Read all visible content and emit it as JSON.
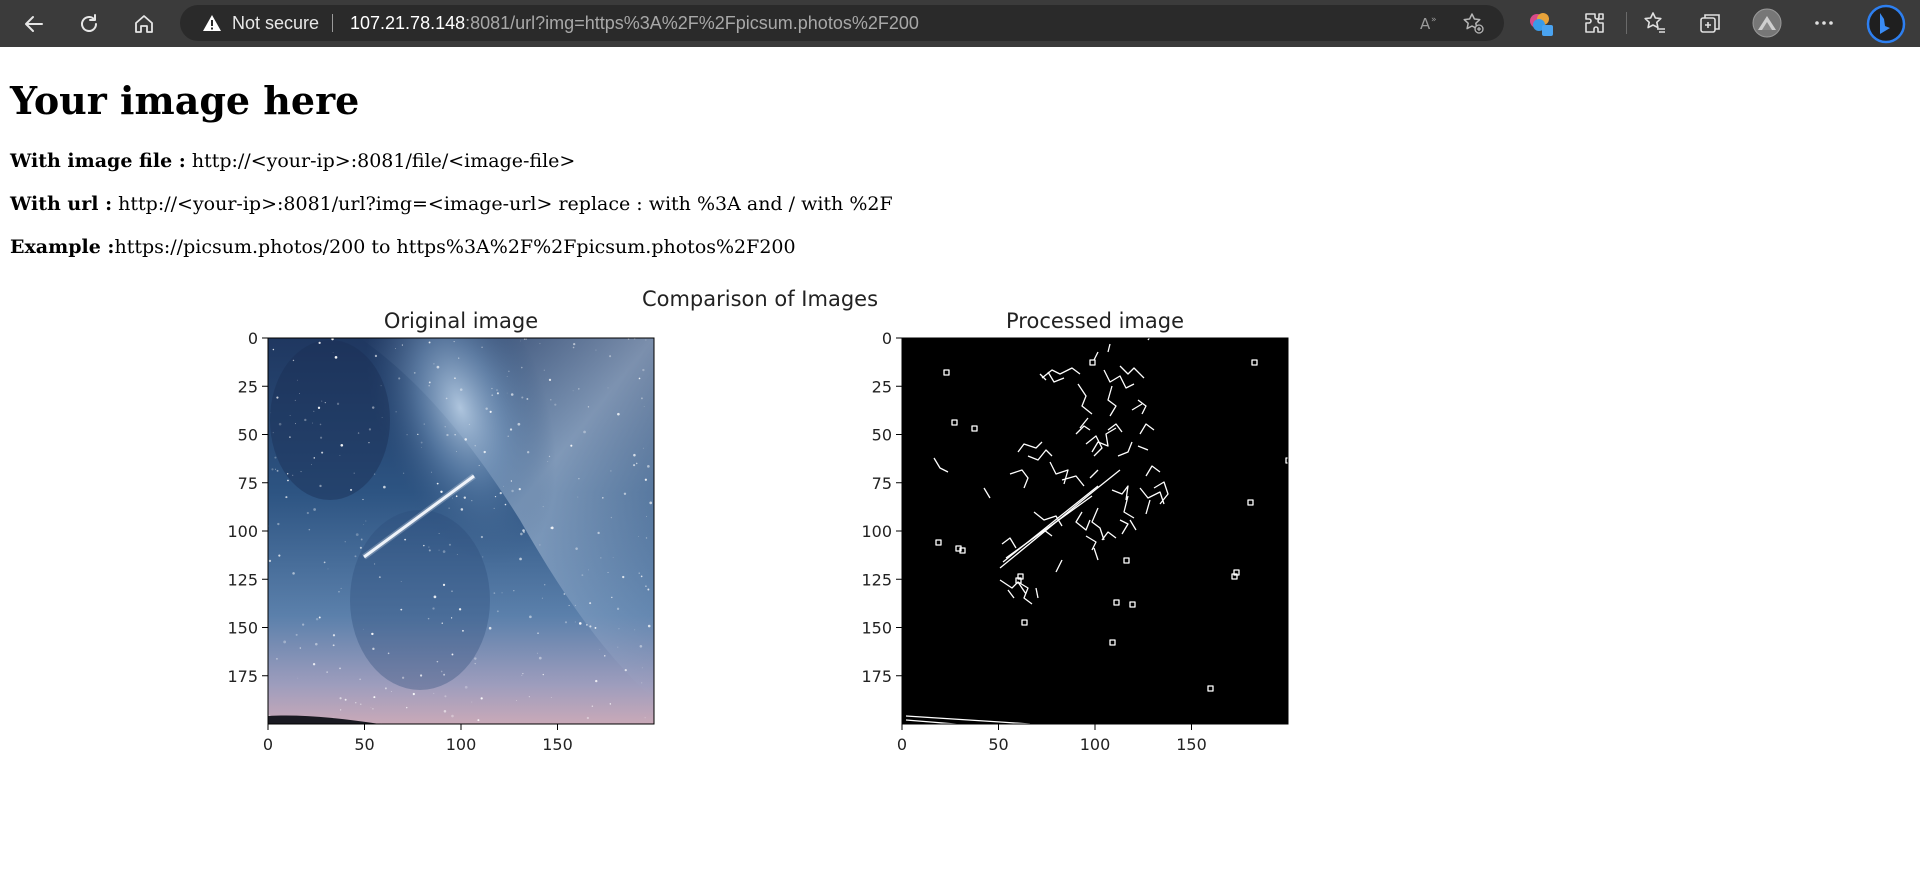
{
  "browser": {
    "security_label": "Not secure",
    "url_host": "107.21.78.148",
    "url_rest": ":8081/url?img=https%3A%2F%2Fpicsum.photos%2F200",
    "icons": [
      "back-arrow-icon",
      "refresh-icon",
      "home-icon",
      "warning-icon",
      "read-aloud-icon",
      "add-favorite-icon",
      "copilot-icon",
      "extensions-icon",
      "favorites-icon",
      "collections-icon",
      "profile-avatar-icon",
      "more-icon",
      "bing-icon"
    ]
  },
  "page": {
    "title": "Your image here",
    "file_label": "With image file :",
    "file_value": " http://<your-ip>:8081/file/<image-file>",
    "url_label": "With url :",
    "url_value": " http://<your-ip>:8081/url?img=<image-url> replace : with %3A and / with %2F",
    "example_label": "Example :",
    "example_value": "https://picsum.photos/200 to https%3A%2F%2Fpicsum.photos%2F200"
  },
  "figure": {
    "suptitle": "Comparison of Images",
    "panels": [
      {
        "title": "Original image",
        "type": "image",
        "source": "starry-night-milky-way"
      },
      {
        "title": "Processed image",
        "type": "image",
        "source": "edge-detection-output"
      }
    ],
    "x_ticks": [
      "0",
      "50",
      "100",
      "150"
    ],
    "y_ticks": [
      "0",
      "25",
      "50",
      "75",
      "100",
      "125",
      "150",
      "175"
    ],
    "xlim": [
      0,
      200
    ],
    "ylim": [
      200,
      0
    ]
  }
}
